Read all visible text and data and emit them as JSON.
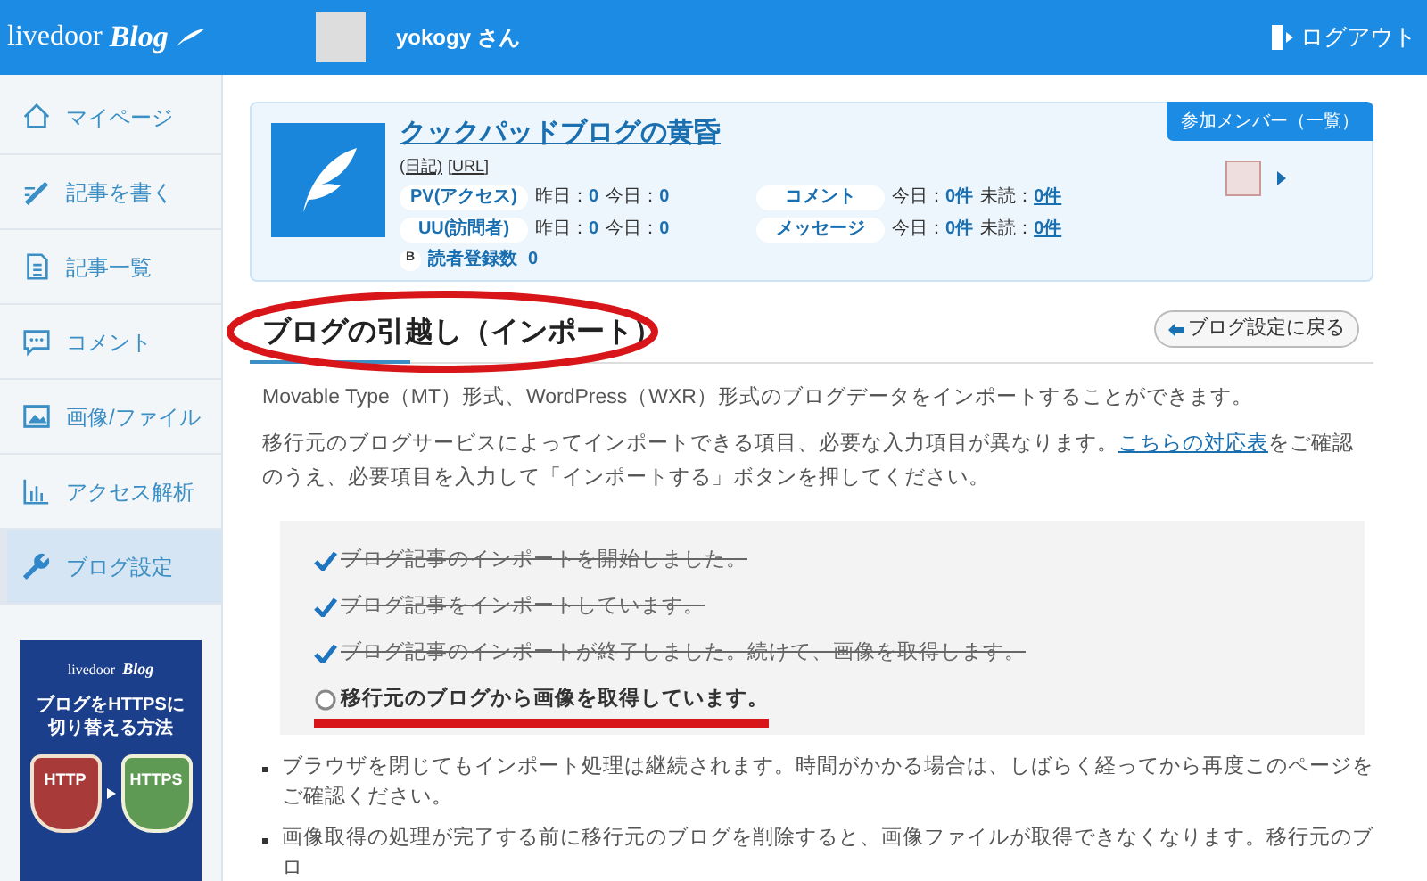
{
  "header": {
    "logo": "livedoor",
    "logo_script": "Blog",
    "user": "yokogy さん",
    "logout": "ログアウト"
  },
  "sidebar": {
    "items": [
      {
        "label": "マイページ",
        "selected": false
      },
      {
        "label": "記事を書く",
        "selected": false
      },
      {
        "label": "記事一覧",
        "selected": false
      },
      {
        "label": "コメント",
        "selected": false
      },
      {
        "label": "画像/ファイル",
        "selected": false
      },
      {
        "label": "アクセス解析",
        "selected": false
      },
      {
        "label": "ブログ設定",
        "selected": true
      }
    ],
    "banner": {
      "brand": "livedoor",
      "brand_script": "Blog",
      "title_lines": [
        "ブログをHTTPSに",
        "切り替える方法"
      ],
      "from": "HTTP",
      "to": "HTTPS"
    }
  },
  "blog_card": {
    "title": "クックパッドブログの黄昏",
    "links": [
      "(日記)",
      "[URL]"
    ],
    "stats": [
      {
        "label": "PV(アクセス)",
        "values": [
          [
            "昨日：",
            "0"
          ],
          [
            "今日：",
            "0"
          ]
        ]
      },
      {
        "label": "UU(訪問者)",
        "values": [
          [
            "昨日：",
            "0"
          ],
          [
            "今日：",
            "0"
          ]
        ]
      }
    ],
    "messages": [
      {
        "label": "コメント",
        "today": [
          "今日：",
          "0件"
        ],
        "unread": [
          "未読：",
          "0件"
        ]
      },
      {
        "label": "メッセージ",
        "today": [
          "今日：",
          "0件"
        ],
        "unread": [
          "未読：",
          "0件"
        ]
      }
    ],
    "readers": {
      "badge": "B",
      "label": "読者登録数",
      "value": "0"
    },
    "members_button": "参加メンバー（一覧）"
  },
  "page": {
    "title": "ブログの引越し（インポート）",
    "back_button": "ブログ設定に戻る",
    "intro": "Movable Type（MT）形式、WordPress（WXR）形式のブログデータをインポートすることができます。",
    "note_before": "移行元のブログサービスによってインポートできる項目、必要な入力項目が異なります。",
    "note_link": "こちらの対応表",
    "note_after": "をご確認のうえ、必要項目を入力して「インポートする」ボタンを押してください。",
    "steps": [
      {
        "text": "ブログ記事のインポートを開始しました。",
        "done": true
      },
      {
        "text": "ブログ記事をインポートしています。",
        "done": true
      },
      {
        "text": "ブログ記事のインポートが終了しました。続けて、画像を取得します。",
        "done": true
      },
      {
        "text": "移行元のブログから画像を取得しています。",
        "done": false
      }
    ],
    "bullets": [
      "ブラウザを閉じてもインポート処理は継続されます。時間がかかる場合は、しばらく経ってから再度このページをご確認ください。",
      "画像取得の処理が完了する前に移行元のブログを削除すると、画像ファイルが取得できなくなります。移行元のブロ"
    ]
  }
}
